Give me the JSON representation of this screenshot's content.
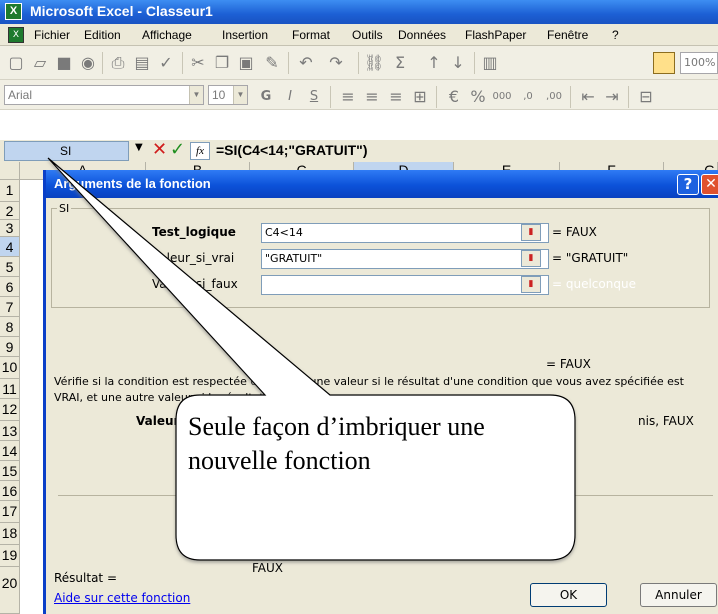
{
  "window": {
    "title": "Microsoft Excel - Classeur1"
  },
  "menu": [
    "Fichier",
    "Edition",
    "Affichage",
    "Insertion",
    "Format",
    "Outils",
    "Données",
    "FlashPaper",
    "Fenêtre",
    "?"
  ],
  "format_toolbar": {
    "font": "Arial",
    "size": "10",
    "zoom": "100%"
  },
  "formula_bar": {
    "name_box": "SI",
    "formula": "=SI(C4<14;\"GRATUIT\")"
  },
  "columns": [
    "A",
    "B",
    "C",
    "D",
    "E",
    "F",
    "G"
  ],
  "rows": [
    "1",
    "2",
    "3",
    "4",
    "5",
    "6",
    "7",
    "8",
    "9",
    "10",
    "11",
    "12",
    "13",
    "14",
    "15",
    "16",
    "17",
    "18",
    "19",
    "20"
  ],
  "dialog": {
    "title": "Arguments de la fonction",
    "group_label": "SI",
    "args": [
      {
        "label": "Test_logique",
        "value": "C4<14",
        "result": "= FAUX"
      },
      {
        "label": "Valeur_si_vrai",
        "value": "\"GRATUIT\"",
        "result": "= \"GRATUIT\""
      },
      {
        "label": "Valeur_si_faux",
        "value": "",
        "result": "= quelconque"
      }
    ],
    "overall_result": "= FAUX",
    "description": "Vérifie si la condition est respectée et renvoie une valeur si le résultat d'une condition que vous avez spécifiée est VRAI, et une autre valeur si le résultat est FAUX.",
    "arg_help_label": "Valeur_si_faux",
    "arg_help_tail": "nis, FAUX",
    "result_label": "Résultat =",
    "result_value": "FAUX",
    "help_link": "Aide sur cette fonction",
    "ok": "OK",
    "cancel": "Annuler"
  },
  "callout": {
    "text": "Seule façon d’imbriquer une nouvelle fonction"
  }
}
